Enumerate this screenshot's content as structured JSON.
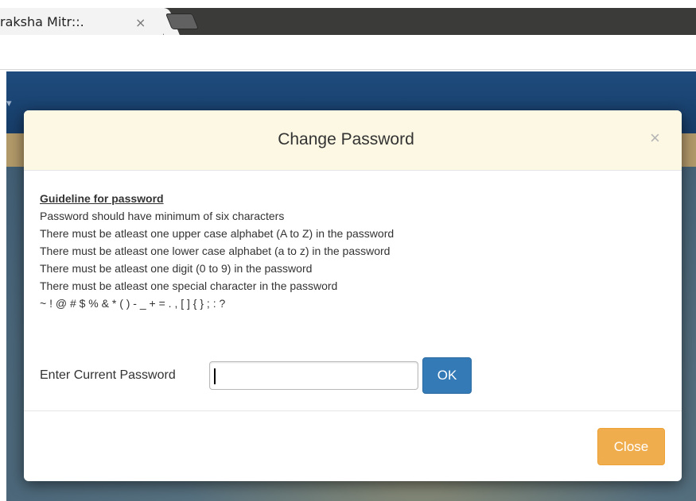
{
  "browser": {
    "tab_title": "raksha Mitr::.",
    "tab_close": "×"
  },
  "modal": {
    "title": "Change Password",
    "close_x": "×",
    "guideline_title": "Guideline for password",
    "guidelines": [
      "Password should have minimum of six characters",
      "There must be atleast one upper case alphabet (A to Z) in the password",
      "There must be atleast one lower case alphabet (a to z) in the password",
      "There must be atleast one digit (0 to 9) in the password",
      "There must be atleast one special character in the password",
      "~ ! @ # $ % & * ( ) - _ + = . , [ ] { } ; : ?"
    ],
    "current_password_label": "Enter Current Password",
    "current_password_value": "",
    "ok_label": "OK",
    "close_label": "Close"
  },
  "colors": {
    "header_bg": "#fcf8e3",
    "ok_bg": "#337ab7",
    "close_bg": "#f0ad4e"
  }
}
